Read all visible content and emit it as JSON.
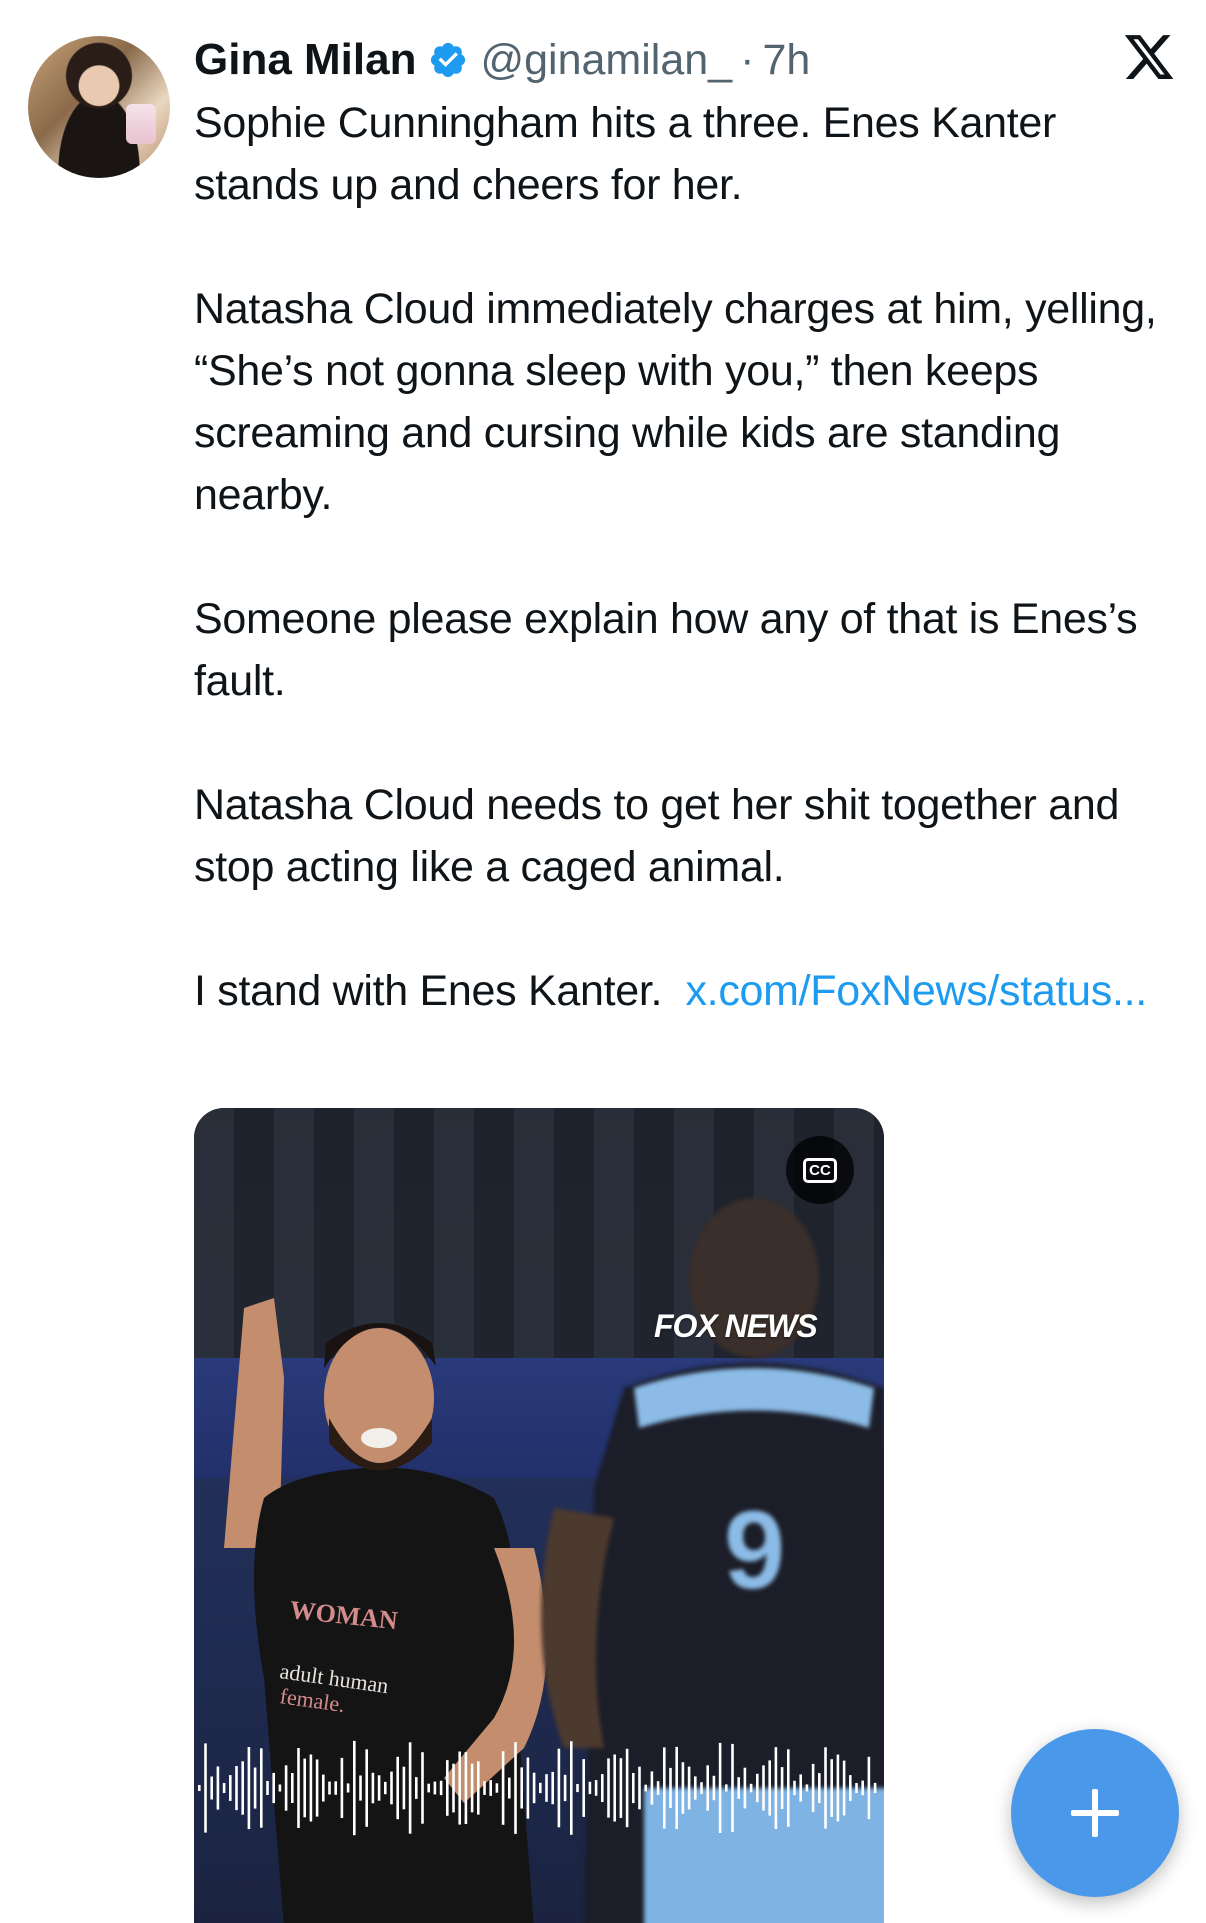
{
  "author": {
    "name": "Gina Milan",
    "handle": "@ginamilan_",
    "separator": "·",
    "time": "7h"
  },
  "tweet": {
    "paragraphs": [
      "Sophie Cunningham hits a three. Enes Kanter stands up and cheers for her.",
      "Natasha Cloud immediately charges at him, yelling, “She’s not gonna sleep with you,” then keeps screaming and cursing while kids are standing nearby.",
      "Someone please explain how any of that is Enes’s fault.",
      "Natasha Cloud needs to get her shit together and stop acting like a caged animal."
    ],
    "last_line_text": "I stand with Enes Kanter.",
    "link_text": "x.com/FoxNews/status..."
  },
  "media": {
    "watermark": "FOX NEWS",
    "cc_label": "CC",
    "shirt_text": "WOMAN adult human female"
  },
  "icons": {
    "verified": "verified-badge-icon",
    "platform": "x-logo-icon",
    "captions": "closed-captions-icon",
    "compose": "plus-icon"
  },
  "colors": {
    "link": "#1d9bf0",
    "verified": "#1d9bf0",
    "fab": "#4a98ea",
    "secondary_text": "#536471"
  }
}
